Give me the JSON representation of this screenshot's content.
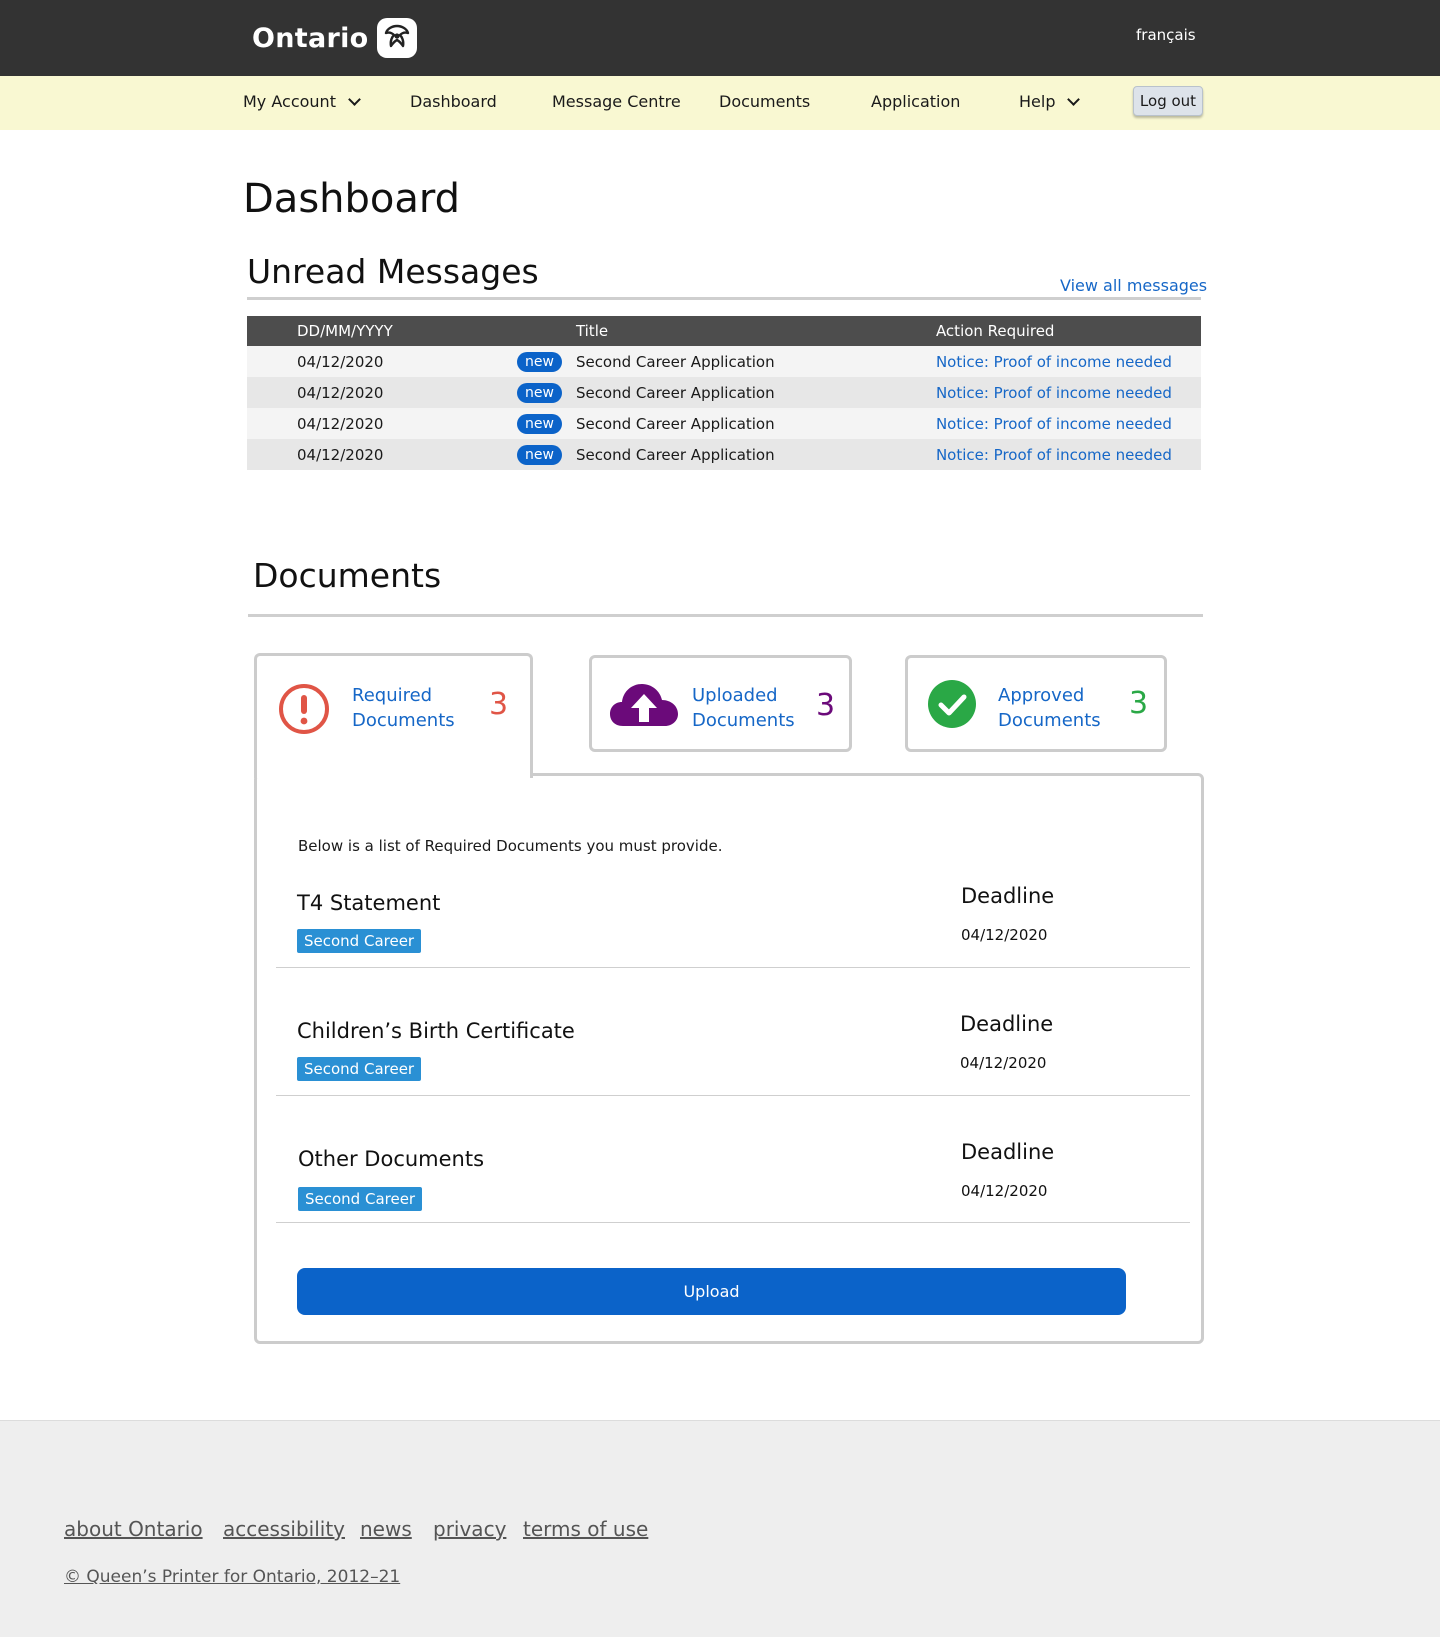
{
  "header": {
    "logo_text": "Ontario",
    "language_link": "français"
  },
  "nav": {
    "items": [
      {
        "label": "My Account",
        "has_dropdown": true
      },
      {
        "label": "Dashboard",
        "has_dropdown": false
      },
      {
        "label": "Message Centre",
        "has_dropdown": false
      },
      {
        "label": "Documents",
        "has_dropdown": false
      },
      {
        "label": "Application",
        "has_dropdown": false
      },
      {
        "label": "Help",
        "has_dropdown": true
      }
    ],
    "logout_label": "Log out"
  },
  "page": {
    "title": "Dashboard"
  },
  "messages": {
    "section_title": "Unread Messages",
    "view_all_label": "View all messages",
    "columns": [
      "DD/MM/YYYY",
      "Title",
      "Action Required"
    ],
    "rows": [
      {
        "date": "04/12/2020",
        "badge": "new",
        "title": "Second Career Application",
        "action": "Notice: Proof of income needed"
      },
      {
        "date": "04/12/2020",
        "badge": "new",
        "title": "Second Career Application",
        "action": "Notice: Proof of income needed"
      },
      {
        "date": "04/12/2020",
        "badge": "new",
        "title": "Second Career Application",
        "action": "Notice: Proof of income needed"
      },
      {
        "date": "04/12/2020",
        "badge": "new",
        "title": "Second Career Application",
        "action": "Notice: Proof of income needed"
      }
    ]
  },
  "documents": {
    "section_title": "Documents",
    "tabs": [
      {
        "line1": "Required",
        "line2": "Documents",
        "count": "3",
        "icon": "alert-circle-icon",
        "color": "#e05546"
      },
      {
        "line1": "Uploaded",
        "line2": "Documents",
        "count": "3",
        "icon": "cloud-upload-icon",
        "color": "#6b0a7a"
      },
      {
        "line1": "Approved",
        "line2": "Documents",
        "count": "3",
        "icon": "check-circle-icon",
        "color": "#2aa846"
      }
    ],
    "intro": "Below is a list of Required Documents you must provide.",
    "deadline_label": "Deadline",
    "items": [
      {
        "name": "T4 Statement",
        "tag": "Second Career",
        "deadline": "04/12/2020"
      },
      {
        "name": "Children’s Birth Certificate",
        "tag": "Second Career",
        "deadline": "04/12/2020"
      },
      {
        "name": "Other Documents",
        "tag": "Second Career",
        "deadline": "04/12/2020"
      }
    ],
    "upload_label": "Upload"
  },
  "footer": {
    "links": [
      "about Ontario",
      "accessibility",
      "news",
      "privacy",
      "terms of use"
    ],
    "copyright": "© Queen’s Printer for Ontario, 2012–21"
  },
  "colors": {
    "header_bg": "#333333",
    "nav_bg": "#f9f8d2",
    "link": "#1667c7",
    "primary_button": "#0b63c9",
    "tag_bg": "#2a90d4"
  }
}
